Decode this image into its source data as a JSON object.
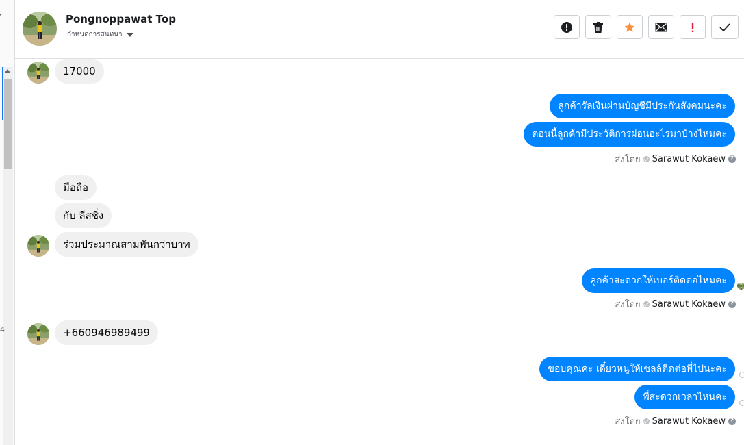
{
  "header": {
    "contact_name": "Pongnoppawat Top",
    "assign_label": "กำหนดการสนทนา"
  },
  "toolbar": [
    {
      "name": "mark-spam-button",
      "icon": "alert-circle-icon"
    },
    {
      "name": "delete-button",
      "icon": "trash-icon"
    },
    {
      "name": "star-button",
      "icon": "star-icon"
    },
    {
      "name": "unread-button",
      "icon": "envelope-icon"
    },
    {
      "name": "follow-up-button",
      "icon": "exclamation-icon"
    },
    {
      "name": "done-button",
      "icon": "checkmark-icon"
    }
  ],
  "rail": {
    "number": "4"
  },
  "messages": {
    "in_1": "17000",
    "out_1a": "ลูกค้ารัลเงินผ่านบัญชีมีประกันสังคมนะคะ",
    "out_1b": "ตอนนี้ลูกค้ามีประวัติการผ่อนอะไรมาบ้างไหมคะ",
    "in_2a": "มือถือ",
    "in_2b": "กับ ลีสซิ่ง",
    "in_2c": "ร่วมประมาณสามพันกว่าบาท",
    "out_2": "ลูกค้าสะดวกให้เบอร์ติดต่อไหมคะ",
    "in_3": "+660946989499",
    "out_3a": "ขอบคุณคะ เดี๋ยวหนูให้เซลล์ติดต่อพี่ไปนะคะ",
    "out_3b": "พี่สะดวกเวลาไหนคะ"
  },
  "sent_by": {
    "prefix": "ส่งโดย",
    "agent": "Sarawut Kokaew",
    "help": "?"
  },
  "colors": {
    "outgoing_bubble": "#0084ff",
    "incoming_bubble": "#f0f0f0",
    "star": "#f7923b",
    "alert": "#e41e3f",
    "scroll_accent": "#1877f2"
  }
}
